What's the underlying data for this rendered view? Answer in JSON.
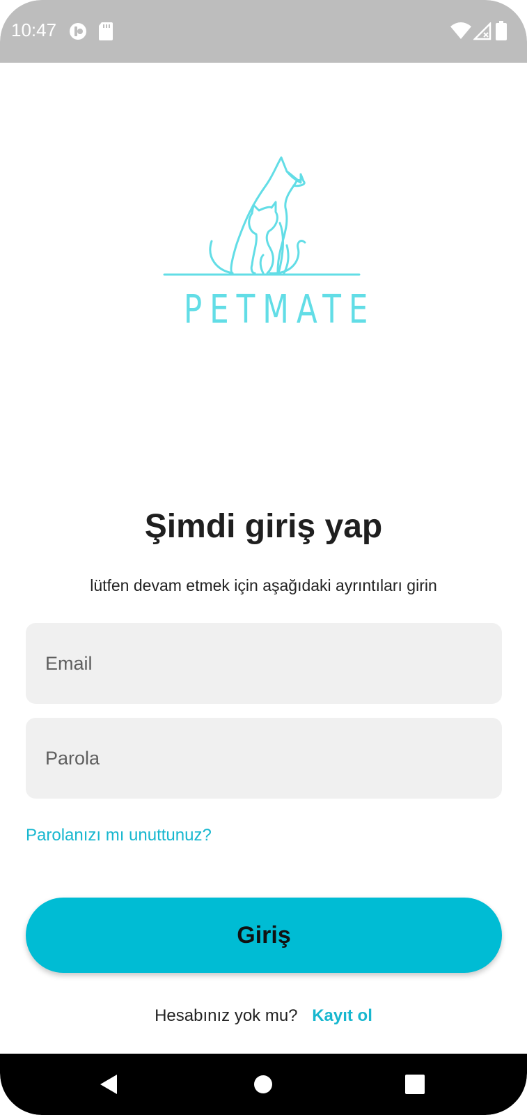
{
  "status_bar": {
    "time": "10:47",
    "icons": [
      "assistant-icon",
      "sd-card-icon",
      "wifi-icon",
      "signal-icon",
      "battery-icon"
    ]
  },
  "logo": {
    "text": "PETMATE",
    "color": "#62dde6",
    "icon": "pet-dog-cat-icon"
  },
  "login": {
    "title": "Şimdi giriş yap",
    "subtitle": "lütfen devam etmek için aşağıdaki ayrıntıları girin",
    "email_placeholder": "Email",
    "password_placeholder": "Parola",
    "forgot_label": "Parolanızı mı unuttunuz?",
    "submit_label": "Giriş",
    "register_prompt": "Hesabınız yok mu?",
    "register_link": "Kayıt ol"
  },
  "colors": {
    "accent": "#00bcd4",
    "link": "#17b7cf",
    "input_bg": "#f0f0f0",
    "status_bar": "#bdbdbd"
  },
  "nav_bar": {
    "buttons": [
      "back-icon",
      "home-icon",
      "recents-icon"
    ]
  }
}
